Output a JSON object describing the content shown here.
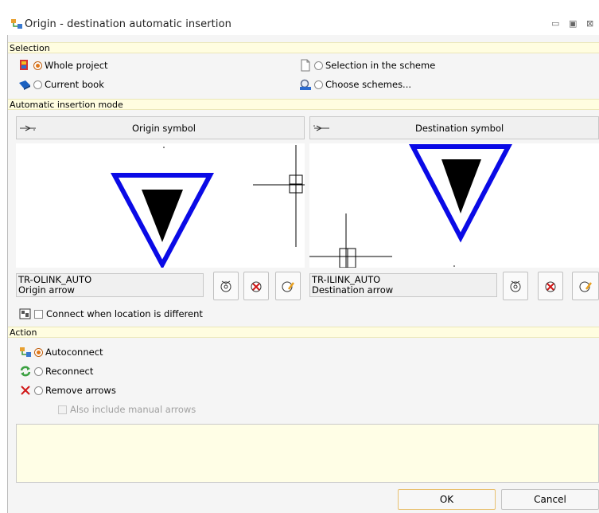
{
  "window": {
    "title": "Origin - destination automatic insertion",
    "controls": [
      "▭",
      "▣",
      "⊠"
    ]
  },
  "selection": {
    "header": "Selection",
    "whole_project": "Whole project",
    "current_book": "Current book",
    "selection_in_scheme": "Selection in the scheme",
    "choose_schemes": "Choose schemes...",
    "selected": "whole_project"
  },
  "insertion": {
    "header": "Automatic insertion mode",
    "origin": {
      "column": "Origin symbol",
      "name": "TR-OLINK_AUTO",
      "desc": "Origin arrow"
    },
    "destination": {
      "column": "Destination symbol",
      "name": "TR-ILINK_AUTO",
      "desc": "Destination arrow"
    },
    "connect_label": "Connect when location is different",
    "connect_checked": false
  },
  "action": {
    "header": "Action",
    "autoconnect": "Autoconnect",
    "reconnect": "Reconnect",
    "remove_arrows": "Remove arrows",
    "also_manual": "Also include manual arrows",
    "selected": "autoconnect"
  },
  "buttons": {
    "ok": "OK",
    "cancel": "Cancel"
  },
  "colors": {
    "section_bg": "#fffde0",
    "arrow_blue": "#0000ee",
    "radio_accent": "#e0781a"
  }
}
